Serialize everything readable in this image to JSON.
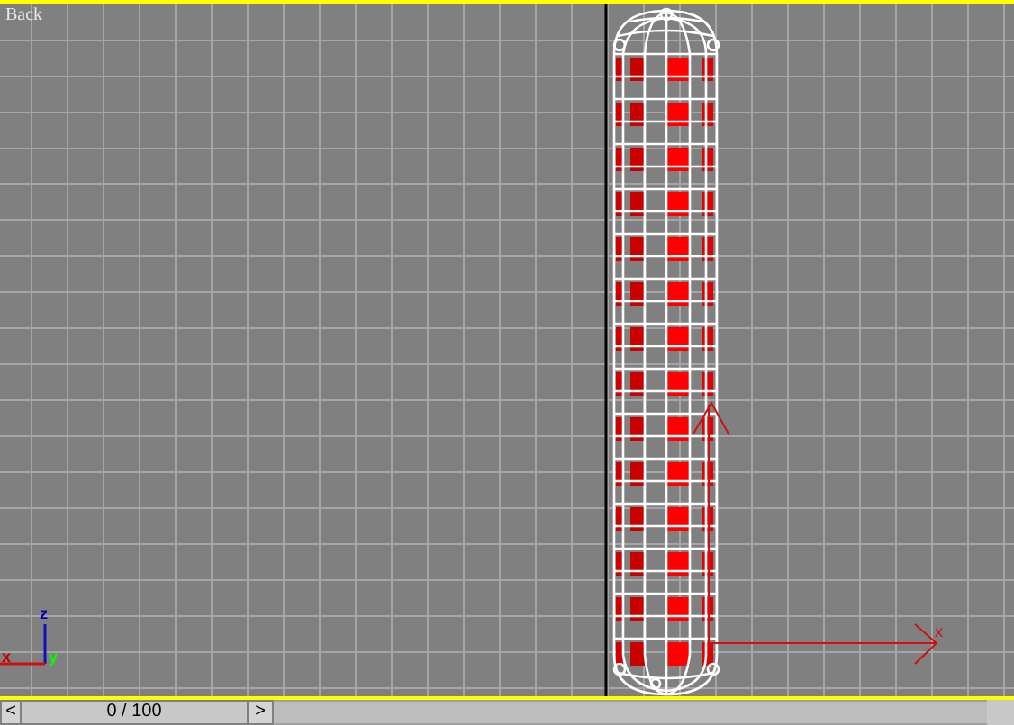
{
  "viewport": {
    "label": "Back",
    "active": true
  },
  "axis_tripod": {
    "labels": [
      {
        "text": "z"
      },
      {
        "text": "x"
      },
      {
        "text": "y"
      }
    ]
  },
  "gizmo": {
    "label": "x"
  },
  "time_slider": {
    "prev": "<",
    "position": "0 / 100",
    "next": ">"
  }
}
